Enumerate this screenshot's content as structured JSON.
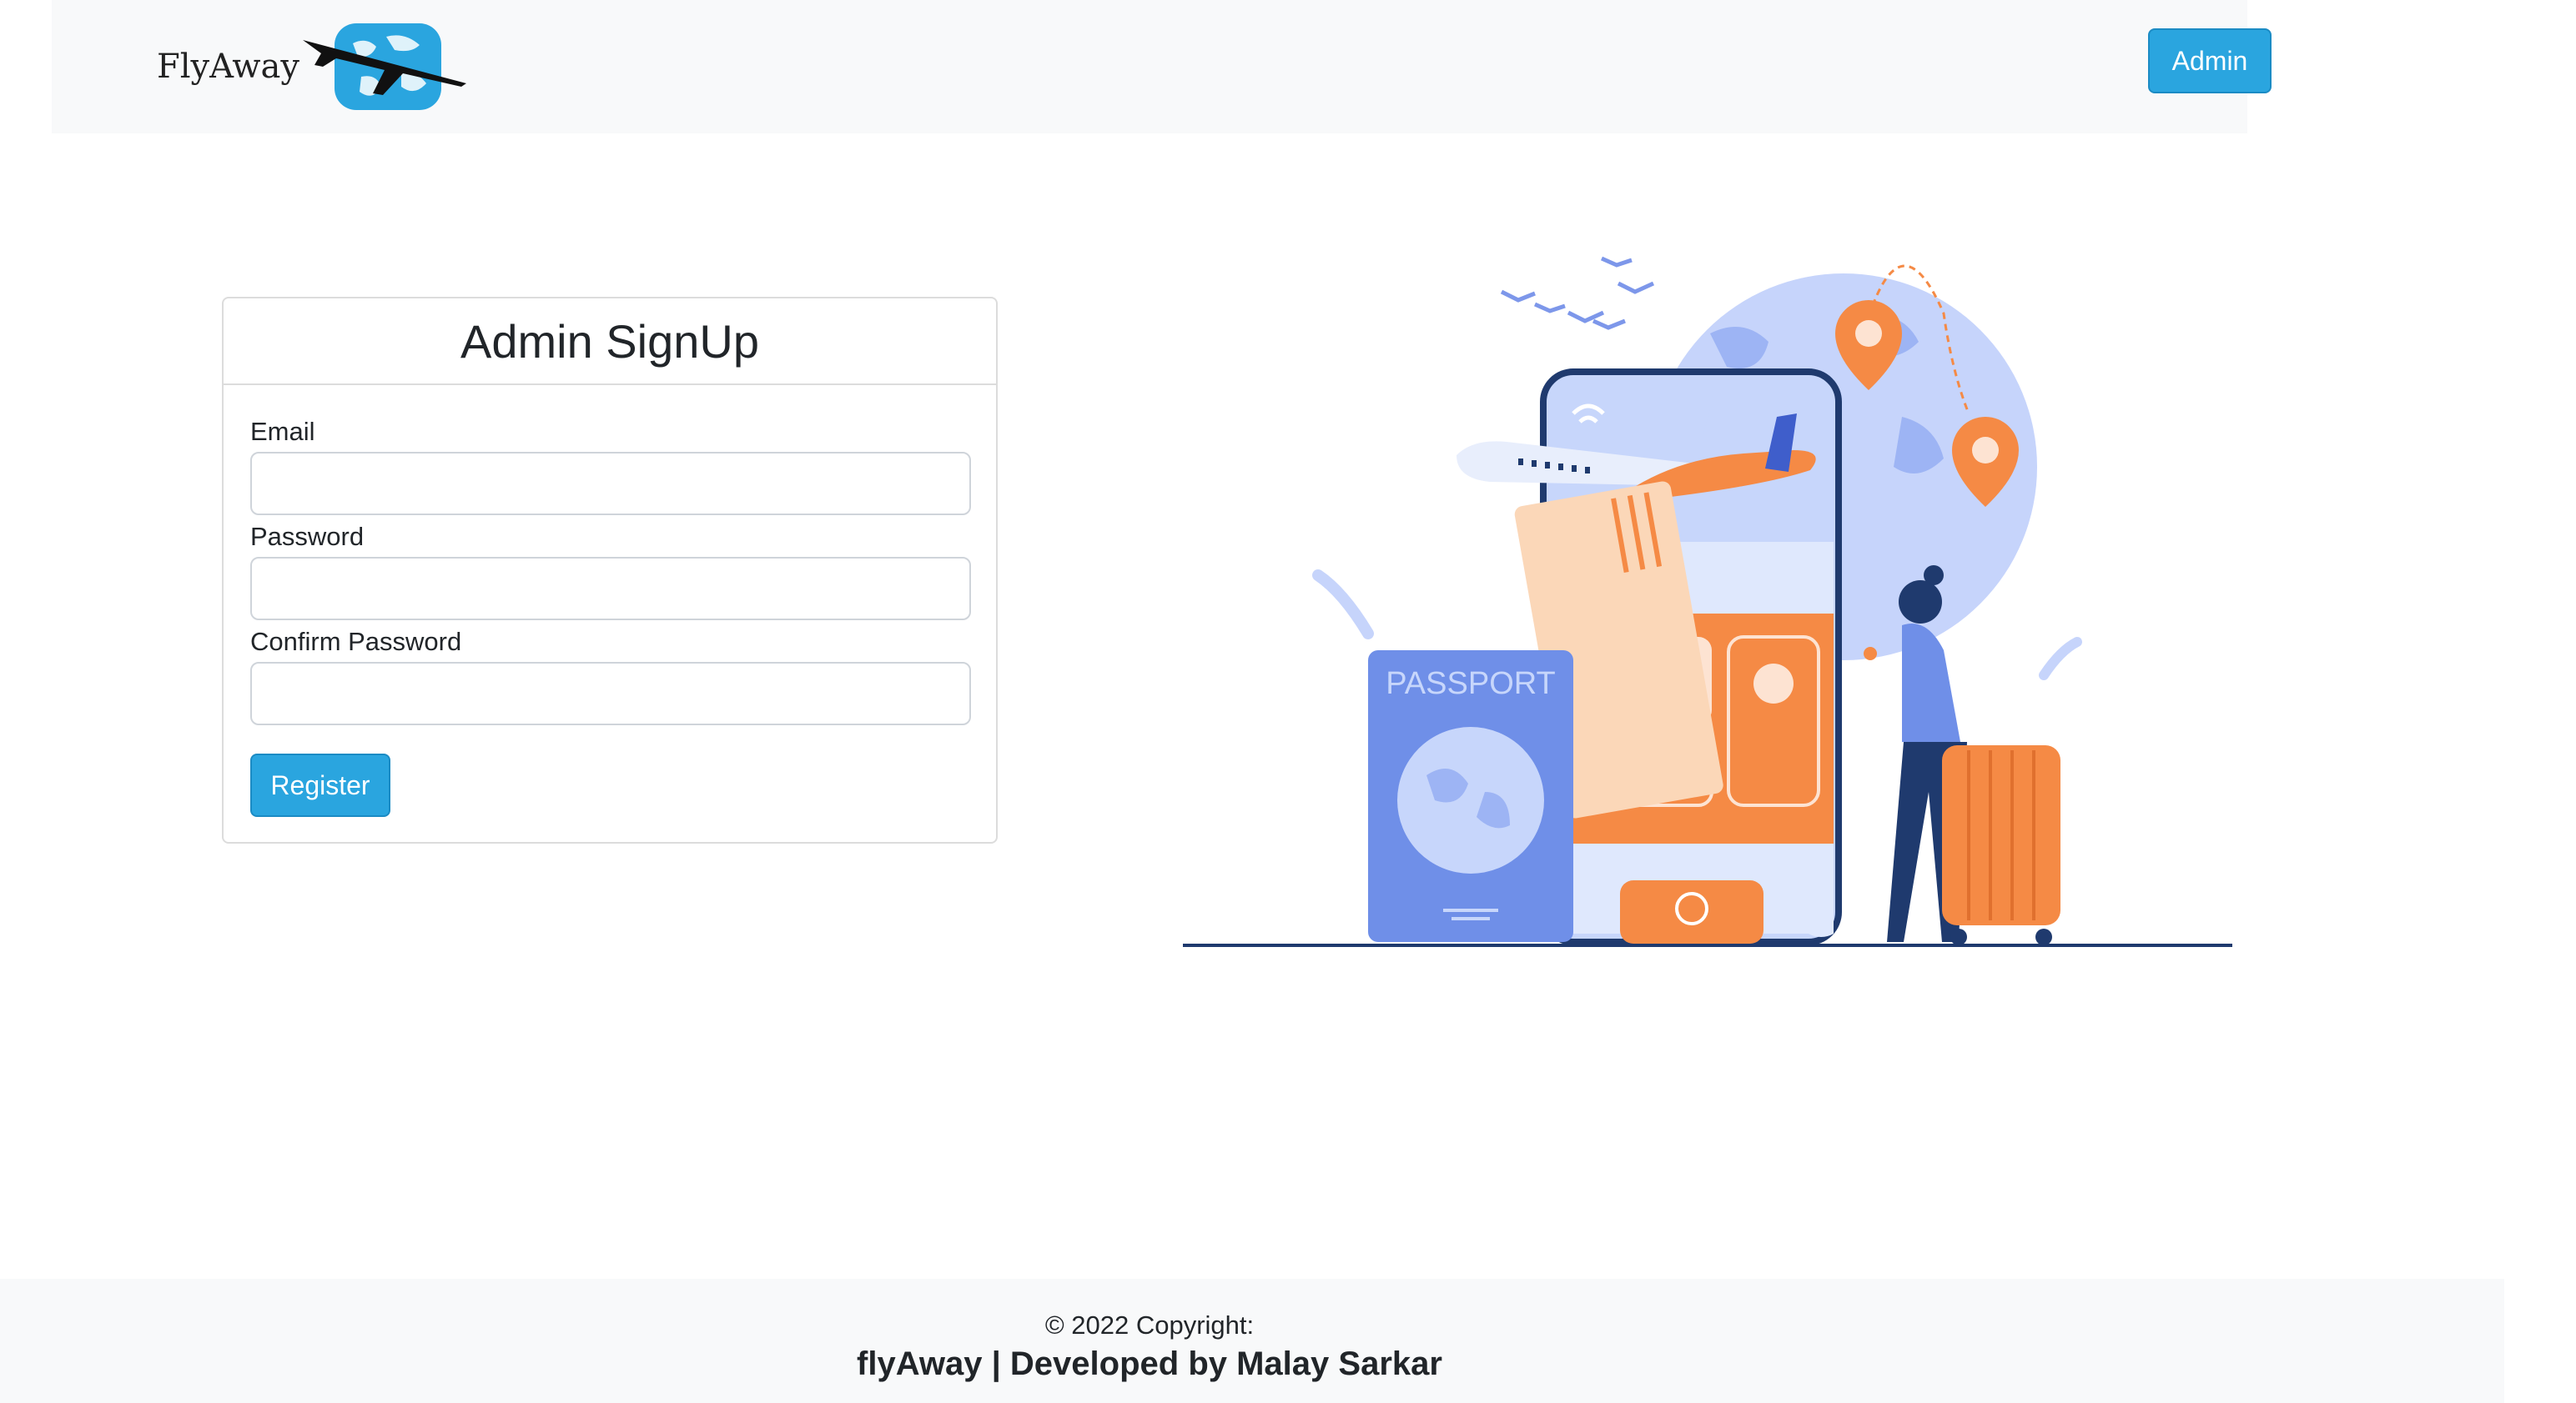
{
  "navbar": {
    "brand_text": "FlyAway",
    "admin_button": "Admin"
  },
  "form": {
    "title": "Admin SignUp",
    "email_label": "Email",
    "email_value": "",
    "password_label": "Password",
    "password_value": "",
    "confirm_label": "Confirm Password",
    "confirm_value": "",
    "register_button": "Register"
  },
  "illustration": {
    "passport_text": "PASSPORT"
  },
  "footer": {
    "copyright": "© 2022 Copyright:",
    "developer": "flyAway | Developed by Malay Sarkar"
  },
  "colors": {
    "primary": "#2aa5df",
    "navbar_bg": "#f8f9fa",
    "illustration_orange": "#f58a45",
    "illustration_blue": "#6f8fe8"
  }
}
